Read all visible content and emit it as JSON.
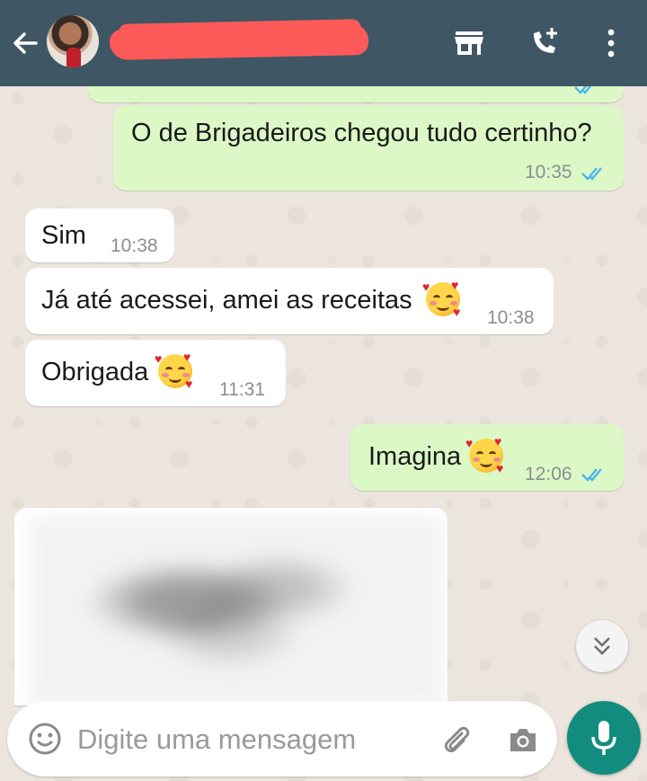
{
  "colors": {
    "header_bg": "#3f5664",
    "outgoing_bubble": "#dcf8c6",
    "incoming_bubble": "#ffffff",
    "read_ticks": "#4fb6ec",
    "accent": "#128c7e"
  },
  "header": {
    "back_icon": "arrow-left-icon",
    "store_icon": "store-icon",
    "call_icon": "add-call-icon",
    "menu_icon": "more-vertical-icon"
  },
  "messages": [
    {
      "direction": "out",
      "text": "O de Brigadeiros chegou tudo certinho?",
      "time": "10:35",
      "status": "read"
    },
    {
      "direction": "in",
      "text": "Sim",
      "time": "10:38"
    },
    {
      "direction": "in",
      "text": "Já até acessei, amei as receitas",
      "emoji": "smiling-face-with-hearts",
      "time": "10:38"
    },
    {
      "direction": "in",
      "text": "Obrigada",
      "emoji": "smiling-face-with-hearts",
      "time": "11:31"
    },
    {
      "direction": "out",
      "text": "Imagina",
      "emoji": "smiling-face-with-hearts",
      "time": "12:06",
      "status": "read"
    }
  ],
  "input": {
    "placeholder": "Digite uma mensagem",
    "emoji_icon": "emoji-icon",
    "attach_icon": "paperclip-icon",
    "camera_icon": "camera-icon"
  },
  "mic_icon": "microphone-icon",
  "scroll_icon": "double-chevron-down-icon"
}
